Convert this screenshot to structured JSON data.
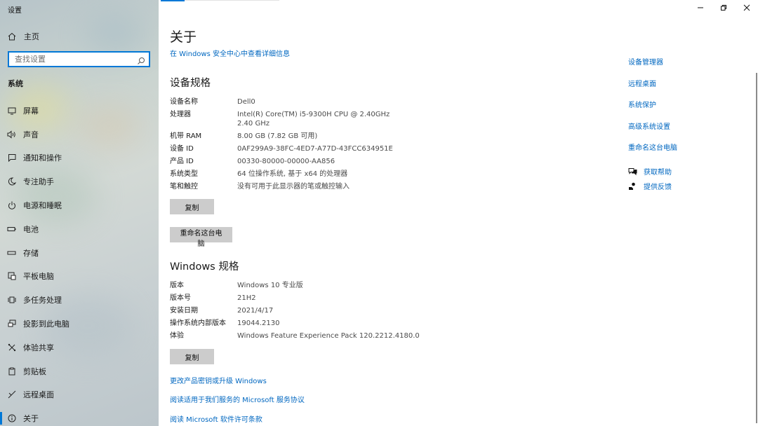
{
  "window": {
    "title": "设置"
  },
  "sidebar": {
    "home": "主页",
    "search_placeholder": "查找设置",
    "section": "系统",
    "items": [
      {
        "label": "屏幕",
        "icon": "display-icon"
      },
      {
        "label": "声音",
        "icon": "speaker-icon"
      },
      {
        "label": "通知和操作",
        "icon": "notification-icon"
      },
      {
        "label": "专注助手",
        "icon": "moon-icon"
      },
      {
        "label": "电源和睡眠",
        "icon": "power-icon"
      },
      {
        "label": "电池",
        "icon": "battery-icon"
      },
      {
        "label": "存储",
        "icon": "storage-icon"
      },
      {
        "label": "平板电脑",
        "icon": "tablet-icon"
      },
      {
        "label": "多任务处理",
        "icon": "multitask-icon"
      },
      {
        "label": "投影到此电脑",
        "icon": "project-icon"
      },
      {
        "label": "体验共享",
        "icon": "share-icon"
      },
      {
        "label": "剪贴板",
        "icon": "clipboard-icon"
      },
      {
        "label": "远程桌面",
        "icon": "remote-icon"
      },
      {
        "label": "关于",
        "icon": "info-icon",
        "active": true
      }
    ]
  },
  "main": {
    "title": "关于",
    "security_link": "在 Windows 安全中心中查看详细信息",
    "device_specs": {
      "heading": "设备规格",
      "rows": [
        {
          "k": "设备名称",
          "v": "Dell0"
        },
        {
          "k": "处理器",
          "v": "Intel(R) Core(TM) i5-9300H CPU @ 2.40GHz   2.40 GHz"
        },
        {
          "k": "机带 RAM",
          "v": "8.00 GB (7.82 GB 可用)"
        },
        {
          "k": "设备 ID",
          "v": "0AF299A9-38FC-4ED7-A77D-43FCC634951E"
        },
        {
          "k": "产品 ID",
          "v": "00330-80000-00000-AA856"
        },
        {
          "k": "系统类型",
          "v": "64 位操作系统, 基于 x64 的处理器"
        },
        {
          "k": "笔和触控",
          "v": "没有可用于此显示器的笔或触控输入"
        }
      ],
      "copy_button": "复制",
      "rename_button": "重命名这台电脑"
    },
    "windows_specs": {
      "heading": "Windows 规格",
      "rows": [
        {
          "k": "版本",
          "v": "Windows 10 专业版"
        },
        {
          "k": "版本号",
          "v": "21H2"
        },
        {
          "k": "安装日期",
          "v": "2021/4/17"
        },
        {
          "k": "操作系统内部版本",
          "v": "19044.2130"
        },
        {
          "k": "体验",
          "v": "Windows Feature Experience Pack 120.2212.4180.0"
        }
      ],
      "copy_button": "复制"
    },
    "links": [
      "更改产品密钥或升级 Windows",
      "阅读适用于我们服务的 Microsoft 服务协议",
      "阅读 Microsoft 软件许可条款"
    ]
  },
  "related": {
    "links": [
      "设备管理器",
      "远程桌面",
      "系统保护",
      "高级系统设置",
      "重命名这台电脑"
    ],
    "help": [
      {
        "label": "获取帮助",
        "icon": "help-chat-icon"
      },
      {
        "label": "提供反馈",
        "icon": "feedback-icon"
      }
    ]
  },
  "colors": {
    "accent": "#0078d7",
    "link": "#0067c0",
    "button": "#cccccc"
  }
}
